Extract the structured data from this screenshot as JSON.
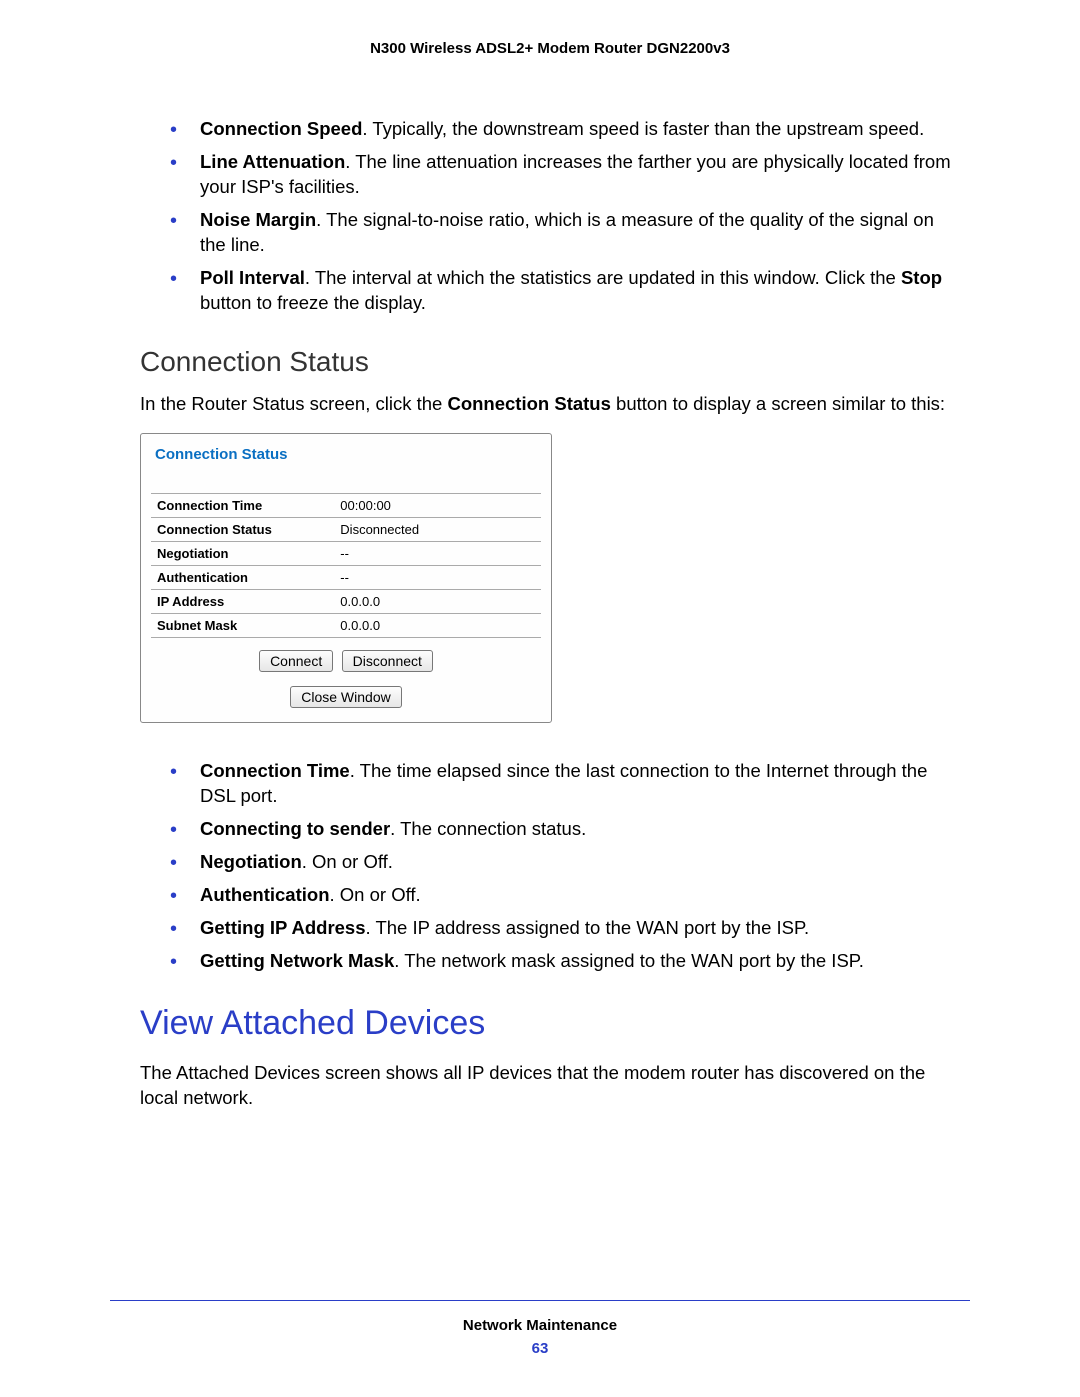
{
  "header": "N300 Wireless ADSL2+ Modem Router DGN2200v3",
  "list1": {
    "i0": {
      "b": "Connection Speed",
      "t": ". Typically, the downstream speed is faster than the upstream speed."
    },
    "i1": {
      "b": "Line Attenuation",
      "t": ". The line attenuation increases the farther you are physically located from your ISP's facilities."
    },
    "i2": {
      "b": "Noise Margin",
      "t": ". The signal-to-noise ratio, which is a measure of the quality of the signal on the line."
    },
    "i3": {
      "b": "Poll Interval",
      "t1": ". The interval at which the statistics are updated in this window. Click the ",
      "b2": "Stop",
      "t2": " button to freeze the display."
    }
  },
  "section1": {
    "title": "Connection Status",
    "intro_a": "In the Router Status screen, click the ",
    "intro_b": "Connection Status",
    "intro_c": " button to display a screen similar to this:"
  },
  "panel": {
    "title": "Connection Status",
    "rows": {
      "r0": {
        "k": "Connection Time",
        "v": "00:00:00"
      },
      "r1": {
        "k": "Connection Status",
        "v": "Disconnected"
      },
      "r2": {
        "k": "Negotiation",
        "v": "--"
      },
      "r3": {
        "k": "Authentication",
        "v": "--"
      },
      "r4": {
        "k": "IP Address",
        "v": "0.0.0.0"
      },
      "r5": {
        "k": "Subnet Mask",
        "v": "0.0.0.0"
      }
    },
    "btn_connect": "Connect",
    "btn_disconnect": "Disconnect",
    "btn_close": "Close Window"
  },
  "list2": {
    "i0": {
      "b": "Connection Time",
      "t": ". The time elapsed since the last connection to the Internet through the DSL port."
    },
    "i1": {
      "b": "Connecting to sender",
      "t": ". The connection status."
    },
    "i2": {
      "b": "Negotiation",
      "t": ". On or Off."
    },
    "i3": {
      "b": "Authentication",
      "t": ". On or Off."
    },
    "i4": {
      "b": "Getting IP Address",
      "t": ". The IP address assigned to the WAN port by the ISP."
    },
    "i5": {
      "b": "Getting Network Mask",
      "t": ". The network mask assigned to the WAN port by the ISP."
    }
  },
  "section2": {
    "title": "View Attached Devices",
    "body": "The Attached Devices screen shows all IP devices that the modem router has discovered on the local network."
  },
  "footer": {
    "text": "Network Maintenance",
    "page": "63"
  }
}
